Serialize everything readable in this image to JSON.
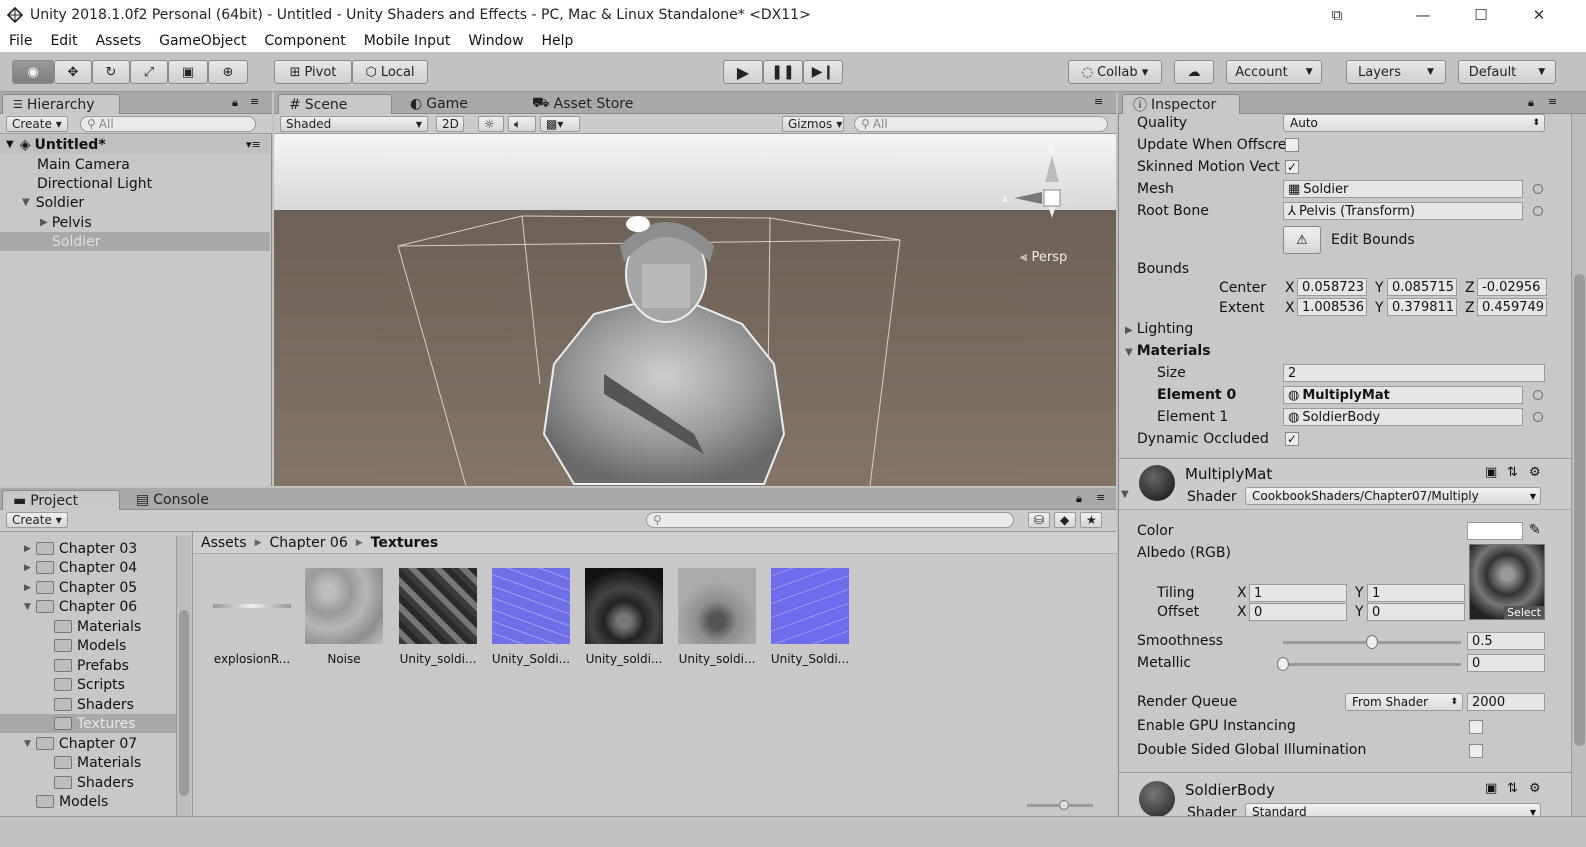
{
  "window": {
    "title": "Unity 2018.1.0f2 Personal (64bit) - Untitled - Unity Shaders and Effects - PC, Mac & Linux Standalone* <DX11>"
  },
  "menu": [
    "File",
    "Edit",
    "Assets",
    "GameObject",
    "Component",
    "Mobile Input",
    "Window",
    "Help"
  ],
  "toolbar": {
    "pivot": "Pivot",
    "local": "Local",
    "collab": "Collab ▾",
    "account": "Account",
    "layers": "Layers",
    "layout": "Default"
  },
  "hierarchy": {
    "tab": "Hierarchy",
    "create": "Create ▾",
    "search": "All",
    "scene": "Untitled*",
    "items": [
      "Main Camera",
      "Directional Light",
      "Soldier",
      "Pelvis",
      "Soldier"
    ]
  },
  "scene": {
    "tabs": [
      "Scene",
      "Game",
      "Asset Store"
    ],
    "shading": "Shaded",
    "mode2d": "2D",
    "gizmos": "Gizmos",
    "search": "All",
    "persp": "Persp"
  },
  "project": {
    "tabs": [
      "Project",
      "Console"
    ],
    "create": "Create ▾",
    "folders": [
      "Chapter 03",
      "Chapter 04",
      "Chapter 05",
      "Chapter 06",
      "Materials",
      "Models",
      "Prefabs",
      "Scripts",
      "Shaders",
      "Textures",
      "Chapter 07",
      "Materials",
      "Shaders",
      "Models"
    ],
    "breadcrumb": [
      "Assets",
      "Chapter 06",
      "Textures"
    ],
    "assets": [
      "explosionR...",
      "Noise",
      "Unity_soldi...",
      "Unity_Soldi...",
      "Unity_soldi...",
      "Unity_soldi...",
      "Unity_Soldi..."
    ]
  },
  "inspector": {
    "tab": "Inspector",
    "quality_label": "Quality",
    "quality_value": "Auto",
    "update_label": "Update When Offscre",
    "skinned_label": "Skinned Motion Vect",
    "mesh_label": "Mesh",
    "mesh_value": "Soldier",
    "rootbone_label": "Root Bone",
    "rootbone_value": "Pelvis (Transform)",
    "editbounds": "Edit Bounds",
    "bounds_label": "Bounds",
    "center_label": "Center",
    "center": [
      "0.058723",
      "0.085715",
      "-0.02956"
    ],
    "extent_label": "Extent",
    "extent": [
      "1.008536",
      "0.379811",
      "0.459749"
    ],
    "axes": [
      "X",
      "Y",
      "Z"
    ],
    "lighting": "Lighting",
    "materials": "Materials",
    "size_label": "Size",
    "size_value": "2",
    "el0_label": "Element 0",
    "el0_value": "MultiplyMat",
    "el1_label": "Element 1",
    "el1_value": "SoldierBody",
    "dynocc_label": "Dynamic Occluded",
    "mat1_name": "MultiplyMat",
    "shader_label": "Shader",
    "mat1_shader": "CookbookShaders/Chapter07/Multiply",
    "color_label": "Color",
    "albedo_label": "Albedo (RGB)",
    "tiling_label": "Tiling",
    "tiling": [
      "1",
      "1"
    ],
    "offset_label": "Offset",
    "offset": [
      "0",
      "0"
    ],
    "select": "Select",
    "smooth_label": "Smoothness",
    "smooth_value": "0.5",
    "metal_label": "Metallic",
    "metal_value": "0",
    "rq_label": "Render Queue",
    "rq_mode": "From Shader",
    "rq_value": "2000",
    "gpu_label": "Enable GPU Instancing",
    "dsgi_label": "Double Sided Global Illumination",
    "mat2_name": "SoldierBody",
    "mat2_shader": "Standard"
  },
  "values": {
    "smoothness": 0.5,
    "metallic": 0
  }
}
